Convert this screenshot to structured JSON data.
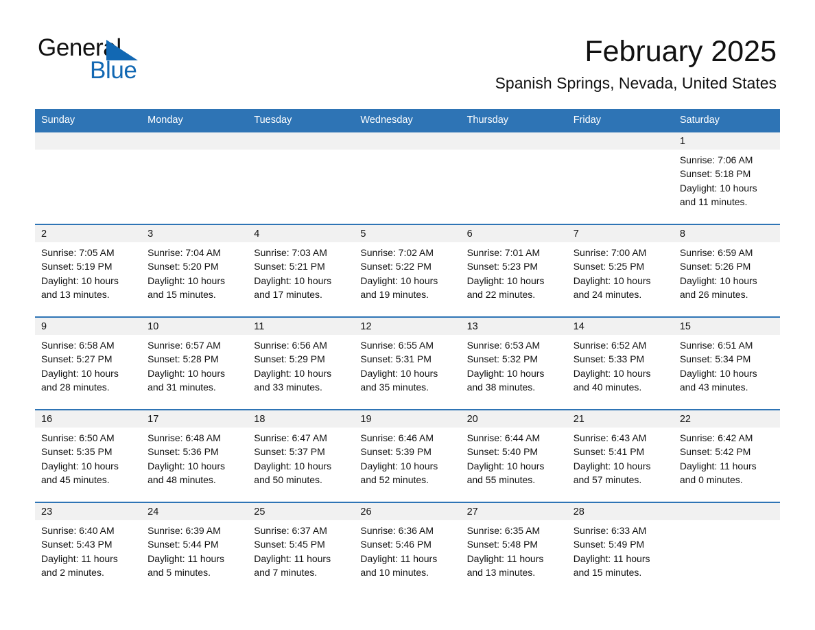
{
  "brand": {
    "name_top": "General",
    "name_bottom": "Blue",
    "accent_color": "#1268b3",
    "header_blue": "#2e74b5"
  },
  "header": {
    "title": "February 2025",
    "location": "Spanish Springs, Nevada, United States"
  },
  "calendar": {
    "weekday_headers": [
      "Sunday",
      "Monday",
      "Tuesday",
      "Wednesday",
      "Thursday",
      "Friday",
      "Saturday"
    ],
    "weeks": [
      [
        {
          "day": "",
          "sunrise": "",
          "sunset": "",
          "daylight": "",
          "empty": true
        },
        {
          "day": "",
          "sunrise": "",
          "sunset": "",
          "daylight": "",
          "empty": true
        },
        {
          "day": "",
          "sunrise": "",
          "sunset": "",
          "daylight": "",
          "empty": true
        },
        {
          "day": "",
          "sunrise": "",
          "sunset": "",
          "daylight": "",
          "empty": true
        },
        {
          "day": "",
          "sunrise": "",
          "sunset": "",
          "daylight": "",
          "empty": true
        },
        {
          "day": "",
          "sunrise": "",
          "sunset": "",
          "daylight": "",
          "empty": true
        },
        {
          "day": "1",
          "sunrise": "Sunrise: 7:06 AM",
          "sunset": "Sunset: 5:18 PM",
          "daylight": "Daylight: 10 hours and 11 minutes.",
          "empty": false
        }
      ],
      [
        {
          "day": "2",
          "sunrise": "Sunrise: 7:05 AM",
          "sunset": "Sunset: 5:19 PM",
          "daylight": "Daylight: 10 hours and 13 minutes.",
          "empty": false
        },
        {
          "day": "3",
          "sunrise": "Sunrise: 7:04 AM",
          "sunset": "Sunset: 5:20 PM",
          "daylight": "Daylight: 10 hours and 15 minutes.",
          "empty": false
        },
        {
          "day": "4",
          "sunrise": "Sunrise: 7:03 AM",
          "sunset": "Sunset: 5:21 PM",
          "daylight": "Daylight: 10 hours and 17 minutes.",
          "empty": false
        },
        {
          "day": "5",
          "sunrise": "Sunrise: 7:02 AM",
          "sunset": "Sunset: 5:22 PM",
          "daylight": "Daylight: 10 hours and 19 minutes.",
          "empty": false
        },
        {
          "day": "6",
          "sunrise": "Sunrise: 7:01 AM",
          "sunset": "Sunset: 5:23 PM",
          "daylight": "Daylight: 10 hours and 22 minutes.",
          "empty": false
        },
        {
          "day": "7",
          "sunrise": "Sunrise: 7:00 AM",
          "sunset": "Sunset: 5:25 PM",
          "daylight": "Daylight: 10 hours and 24 minutes.",
          "empty": false
        },
        {
          "day": "8",
          "sunrise": "Sunrise: 6:59 AM",
          "sunset": "Sunset: 5:26 PM",
          "daylight": "Daylight: 10 hours and 26 minutes.",
          "empty": false
        }
      ],
      [
        {
          "day": "9",
          "sunrise": "Sunrise: 6:58 AM",
          "sunset": "Sunset: 5:27 PM",
          "daylight": "Daylight: 10 hours and 28 minutes.",
          "empty": false
        },
        {
          "day": "10",
          "sunrise": "Sunrise: 6:57 AM",
          "sunset": "Sunset: 5:28 PM",
          "daylight": "Daylight: 10 hours and 31 minutes.",
          "empty": false
        },
        {
          "day": "11",
          "sunrise": "Sunrise: 6:56 AM",
          "sunset": "Sunset: 5:29 PM",
          "daylight": "Daylight: 10 hours and 33 minutes.",
          "empty": false
        },
        {
          "day": "12",
          "sunrise": "Sunrise: 6:55 AM",
          "sunset": "Sunset: 5:31 PM",
          "daylight": "Daylight: 10 hours and 35 minutes.",
          "empty": false
        },
        {
          "day": "13",
          "sunrise": "Sunrise: 6:53 AM",
          "sunset": "Sunset: 5:32 PM",
          "daylight": "Daylight: 10 hours and 38 minutes.",
          "empty": false
        },
        {
          "day": "14",
          "sunrise": "Sunrise: 6:52 AM",
          "sunset": "Sunset: 5:33 PM",
          "daylight": "Daylight: 10 hours and 40 minutes.",
          "empty": false
        },
        {
          "day": "15",
          "sunrise": "Sunrise: 6:51 AM",
          "sunset": "Sunset: 5:34 PM",
          "daylight": "Daylight: 10 hours and 43 minutes.",
          "empty": false
        }
      ],
      [
        {
          "day": "16",
          "sunrise": "Sunrise: 6:50 AM",
          "sunset": "Sunset: 5:35 PM",
          "daylight": "Daylight: 10 hours and 45 minutes.",
          "empty": false
        },
        {
          "day": "17",
          "sunrise": "Sunrise: 6:48 AM",
          "sunset": "Sunset: 5:36 PM",
          "daylight": "Daylight: 10 hours and 48 minutes.",
          "empty": false
        },
        {
          "day": "18",
          "sunrise": "Sunrise: 6:47 AM",
          "sunset": "Sunset: 5:37 PM",
          "daylight": "Daylight: 10 hours and 50 minutes.",
          "empty": false
        },
        {
          "day": "19",
          "sunrise": "Sunrise: 6:46 AM",
          "sunset": "Sunset: 5:39 PM",
          "daylight": "Daylight: 10 hours and 52 minutes.",
          "empty": false
        },
        {
          "day": "20",
          "sunrise": "Sunrise: 6:44 AM",
          "sunset": "Sunset: 5:40 PM",
          "daylight": "Daylight: 10 hours and 55 minutes.",
          "empty": false
        },
        {
          "day": "21",
          "sunrise": "Sunrise: 6:43 AM",
          "sunset": "Sunset: 5:41 PM",
          "daylight": "Daylight: 10 hours and 57 minutes.",
          "empty": false
        },
        {
          "day": "22",
          "sunrise": "Sunrise: 6:42 AM",
          "sunset": "Sunset: 5:42 PM",
          "daylight": "Daylight: 11 hours and 0 minutes.",
          "empty": false
        }
      ],
      [
        {
          "day": "23",
          "sunrise": "Sunrise: 6:40 AM",
          "sunset": "Sunset: 5:43 PM",
          "daylight": "Daylight: 11 hours and 2 minutes.",
          "empty": false
        },
        {
          "day": "24",
          "sunrise": "Sunrise: 6:39 AM",
          "sunset": "Sunset: 5:44 PM",
          "daylight": "Daylight: 11 hours and 5 minutes.",
          "empty": false
        },
        {
          "day": "25",
          "sunrise": "Sunrise: 6:37 AM",
          "sunset": "Sunset: 5:45 PM",
          "daylight": "Daylight: 11 hours and 7 minutes.",
          "empty": false
        },
        {
          "day": "26",
          "sunrise": "Sunrise: 6:36 AM",
          "sunset": "Sunset: 5:46 PM",
          "daylight": "Daylight: 11 hours and 10 minutes.",
          "empty": false
        },
        {
          "day": "27",
          "sunrise": "Sunrise: 6:35 AM",
          "sunset": "Sunset: 5:48 PM",
          "daylight": "Daylight: 11 hours and 13 minutes.",
          "empty": false
        },
        {
          "day": "28",
          "sunrise": "Sunrise: 6:33 AM",
          "sunset": "Sunset: 5:49 PM",
          "daylight": "Daylight: 11 hours and 15 minutes.",
          "empty": false
        },
        {
          "day": "",
          "sunrise": "",
          "sunset": "",
          "daylight": "",
          "empty": true
        }
      ]
    ]
  }
}
